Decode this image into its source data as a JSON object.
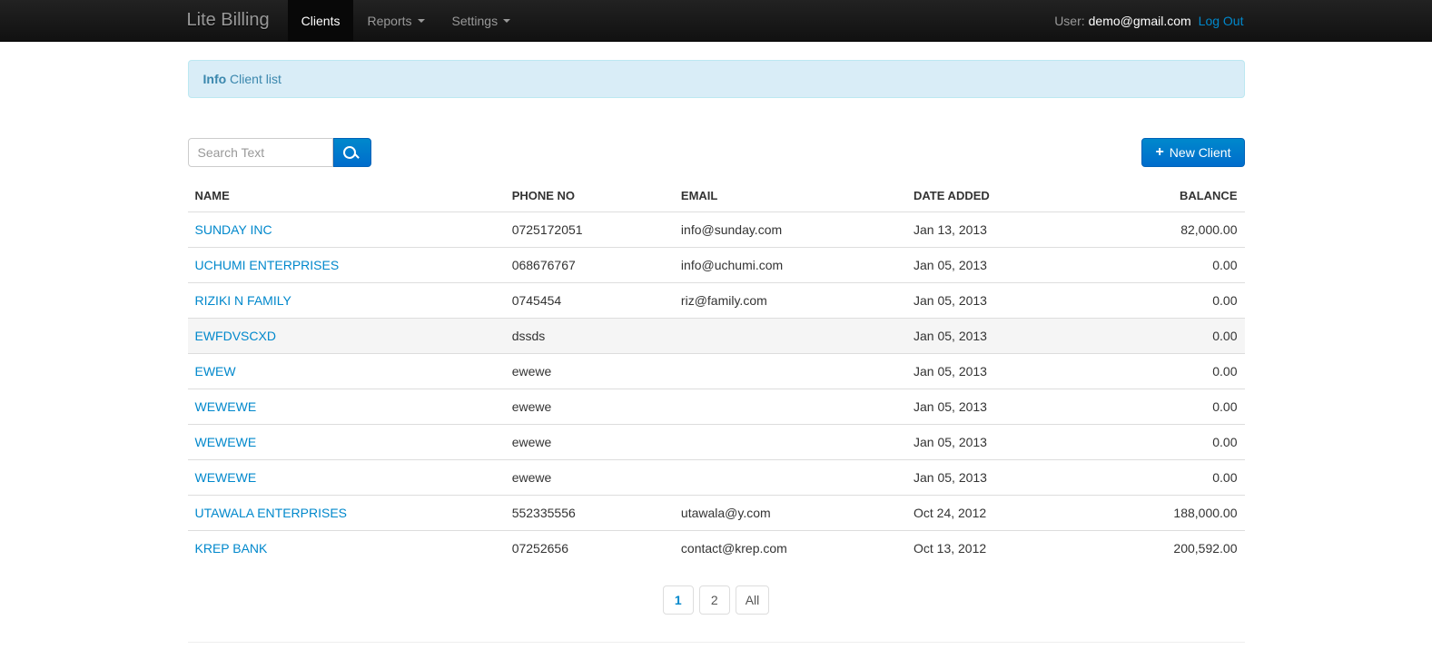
{
  "brand": "Lite Billing",
  "nav": {
    "clients": "Clients",
    "reports": "Reports",
    "settings": "Settings"
  },
  "navbar_right": {
    "user_label": "User:",
    "user_email": "demo@gmail.com",
    "logout": "Log Out"
  },
  "alert": {
    "strong": "Info",
    "text": "Client list"
  },
  "search": {
    "placeholder": "Search Text"
  },
  "new_client_label": "New Client",
  "table": {
    "headers": {
      "name": "NAME",
      "phone": "PHONE NO",
      "email": "EMAIL",
      "date": "DATE ADDED",
      "balance": "BALANCE"
    },
    "rows": [
      {
        "name": "SUNDAY INC",
        "phone": "0725172051",
        "email": "info@sunday.com",
        "date": "Jan 13, 2013",
        "balance": "82,000.00"
      },
      {
        "name": "UCHUMI ENTERPRISES",
        "phone": "068676767",
        "email": "info@uchumi.com",
        "date": "Jan 05, 2013",
        "balance": "0.00"
      },
      {
        "name": "RIZIKI N FAMILY",
        "phone": "0745454",
        "email": "riz@family.com",
        "date": "Jan 05, 2013",
        "balance": "0.00"
      },
      {
        "name": "EWFDVSCXD",
        "phone": "dssds",
        "email": "",
        "date": "Jan 05, 2013",
        "balance": "0.00",
        "hover": true
      },
      {
        "name": "EWEW",
        "phone": "ewewe",
        "email": "",
        "date": "Jan 05, 2013",
        "balance": "0.00"
      },
      {
        "name": "WEWEWE",
        "phone": "ewewe",
        "email": "",
        "date": "Jan 05, 2013",
        "balance": "0.00"
      },
      {
        "name": "WEWEWE",
        "phone": "ewewe",
        "email": "",
        "date": "Jan 05, 2013",
        "balance": "0.00"
      },
      {
        "name": "WEWEWE",
        "phone": "ewewe",
        "email": "",
        "date": "Jan 05, 2013",
        "balance": "0.00"
      },
      {
        "name": "UTAWALA ENTERPRISES",
        "phone": "552335556",
        "email": "utawala@y.com",
        "date": "Oct 24, 2012",
        "balance": "188,000.00"
      },
      {
        "name": "KREP BANK",
        "phone": "07252656",
        "email": "contact@krep.com",
        "date": "Oct 13, 2012",
        "balance": "200,592.00"
      }
    ]
  },
  "pagination": {
    "pages": [
      "1",
      "2",
      "All"
    ],
    "active_index": 0
  }
}
